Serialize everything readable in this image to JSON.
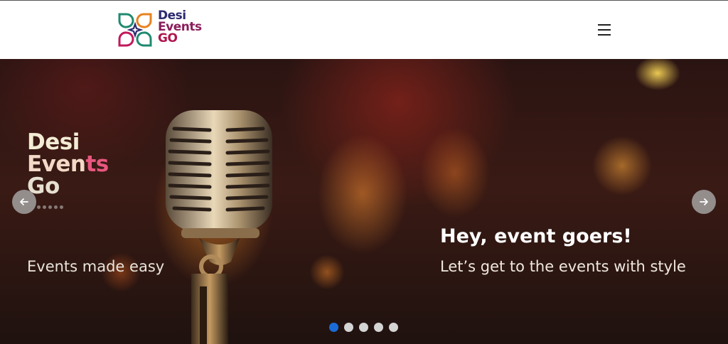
{
  "header": {
    "logo": {
      "line1": "Desi",
      "line2": "Events",
      "line3": "GO"
    },
    "menu_icon": "hamburger-menu-icon"
  },
  "hero": {
    "banner_logo": {
      "line1": "Desi",
      "line2_start": "Even",
      "line2_accent": "ts",
      "line3": "Go"
    },
    "tagline": "Events made easy",
    "caption_title": "Hey, event goers!",
    "caption_subtitle": "Let’s get to the events with style",
    "prev_icon": "arrow-left-icon",
    "next_icon": "arrow-right-icon",
    "slide_count": 5,
    "active_slide": 1
  },
  "colors": {
    "brand_navy": "#2d2a6e",
    "brand_magenta": "#b0154f",
    "active_dot": "#1a6bd8",
    "inactive_dot": "#d4d4d4"
  }
}
